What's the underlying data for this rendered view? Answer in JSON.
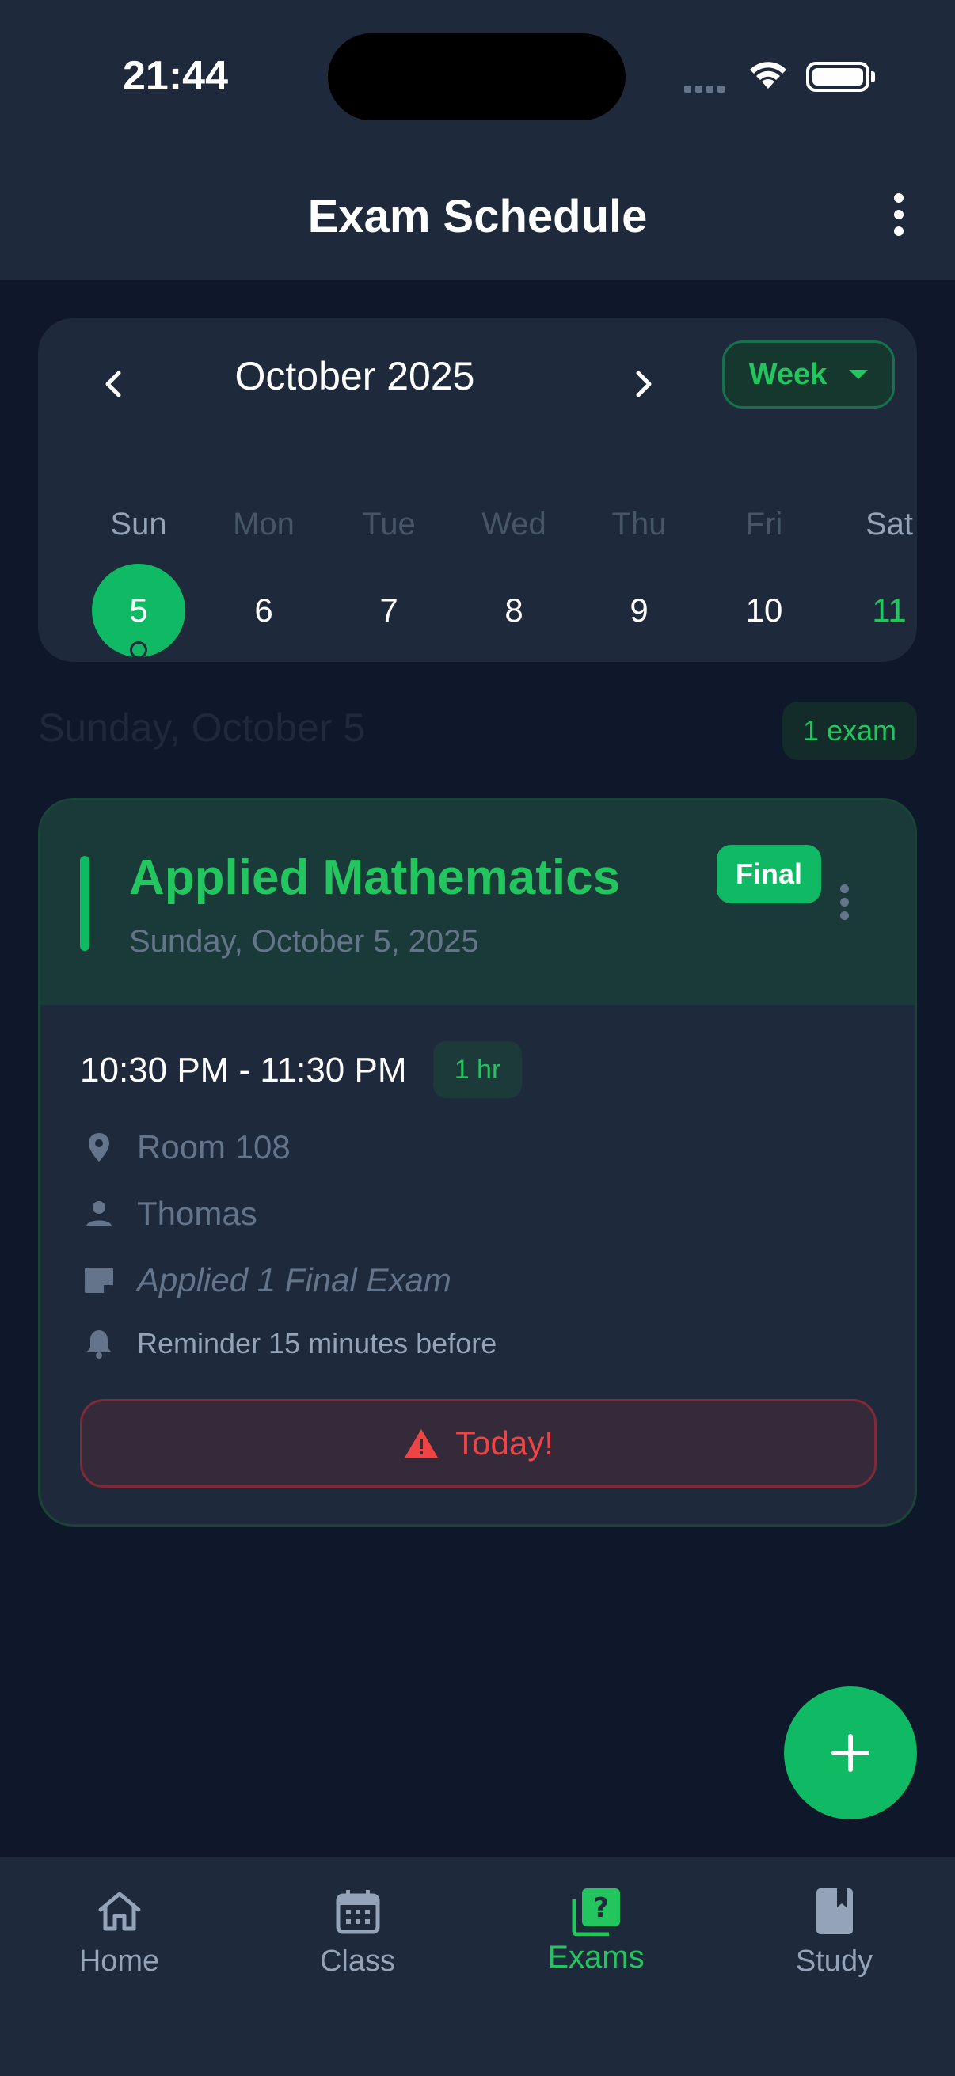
{
  "status": {
    "time": "21:44"
  },
  "header": {
    "title": "Exam Schedule"
  },
  "calendar": {
    "month": "October 2025",
    "view": "Week",
    "days": [
      {
        "name": "Sun",
        "num": "5"
      },
      {
        "name": "Mon",
        "num": "6"
      },
      {
        "name": "Tue",
        "num": "7"
      },
      {
        "name": "Wed",
        "num": "8"
      },
      {
        "name": "Thu",
        "num": "9"
      },
      {
        "name": "Fri",
        "num": "10"
      },
      {
        "name": "Sat",
        "num": "11"
      }
    ]
  },
  "section": {
    "date": "Sunday, October 5",
    "count": "1 exam"
  },
  "exam": {
    "subject": "Applied Mathematics",
    "date": "Sunday, October 5, 2025",
    "type": "Final",
    "time_range": "10:30 PM - 11:30 PM",
    "duration": "1 hr",
    "room": "Room 108",
    "teacher": "Thomas",
    "note": "Applied 1 Final Exam",
    "reminder": "Reminder 15 minutes before",
    "alert": "Today!"
  },
  "nav": [
    {
      "label": "Home",
      "icon": "home-icon"
    },
    {
      "label": "Class",
      "icon": "calendar-icon"
    },
    {
      "label": "Exams",
      "icon": "exam-icon"
    },
    {
      "label": "Study",
      "icon": "book-icon"
    }
  ],
  "colors": {
    "accent": "#10b964",
    "background": "#0f172a",
    "surface": "#1e293b",
    "alert": "#ef4444"
  }
}
